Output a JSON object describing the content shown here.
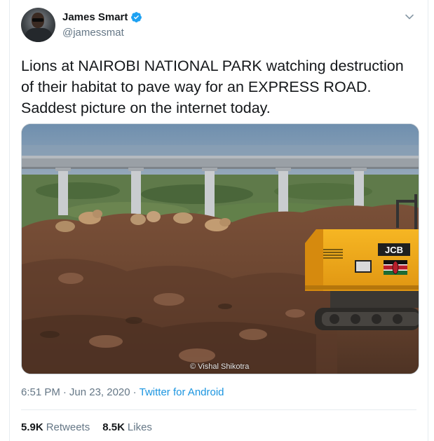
{
  "tweet": {
    "author": {
      "display_name": "James Smart",
      "handle": "@jamessmat",
      "verified": true
    },
    "text": "Lions at NAIROBI NATIONAL PARK watching destruction\nof their habitat to pave way for an EXPRESS ROAD.\nSaddest picture on the internet today.",
    "media": {
      "photo_credit": "© Vishal Shikotra",
      "excavator_brand": "JCB"
    },
    "meta": {
      "time": "6:51 PM",
      "separator_1": "·",
      "date": "Jun 23, 2020",
      "separator_2": "·",
      "client": "Twitter for Android"
    },
    "stats": {
      "retweets_count": "5.9K",
      "retweets_label": "Retweets",
      "likes_count": "8.5K",
      "likes_label": "Likes"
    }
  },
  "colors": {
    "accent": "#1da1f2",
    "link": "#1b95e0",
    "secondary_text": "#657786"
  },
  "icons": {
    "verified": "verified-badge-icon",
    "menu": "chevron-down-icon"
  }
}
